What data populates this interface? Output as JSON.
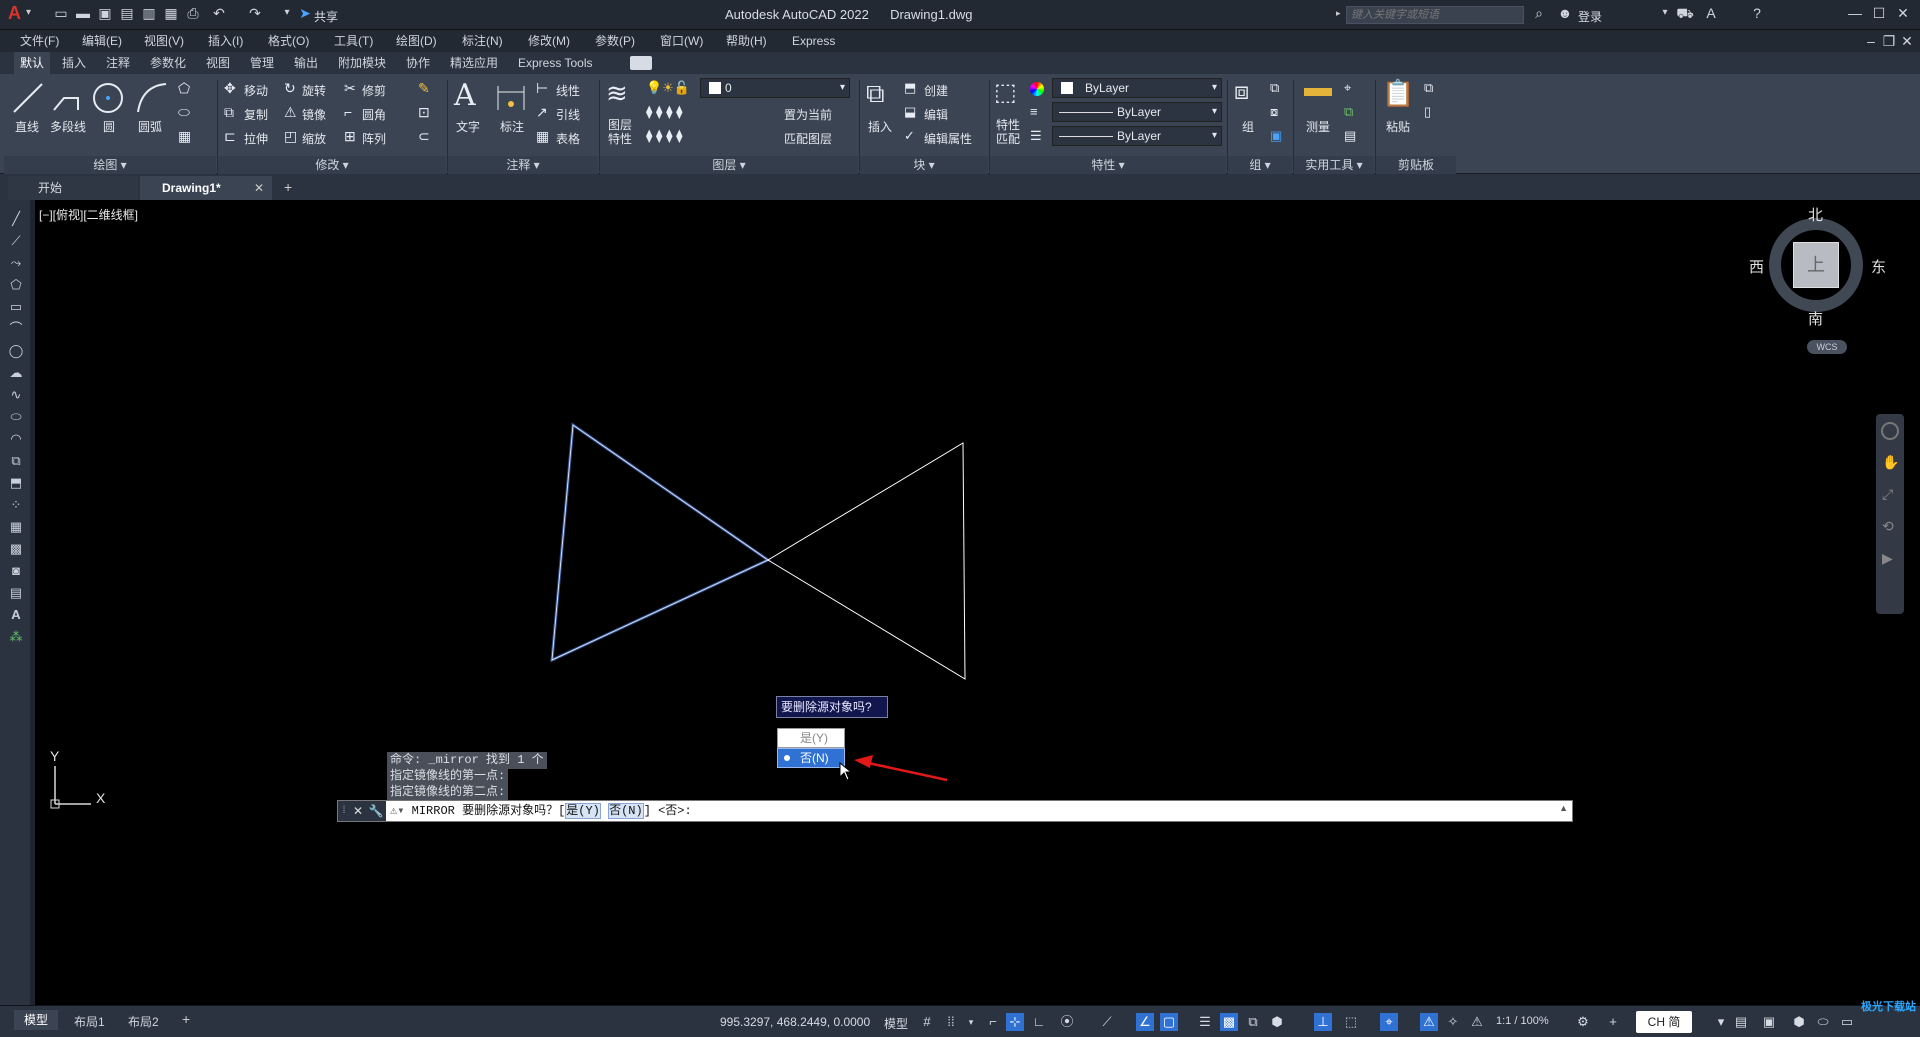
{
  "app": {
    "title": "Autodesk AutoCAD 2022",
    "file": "Drawing1.dwg",
    "logo": "A"
  },
  "titlebar": {
    "share_label": "共享",
    "search_placeholder": "键入关键字或短语",
    "login_label": "登录"
  },
  "menu": [
    "文件(F)",
    "编辑(E)",
    "视图(V)",
    "插入(I)",
    "格式(O)",
    "工具(T)",
    "绘图(D)",
    "标注(N)",
    "修改(M)",
    "参数(P)",
    "窗口(W)",
    "帮助(H)",
    "Express"
  ],
  "ribbon_tabs": [
    "默认",
    "插入",
    "注释",
    "参数化",
    "视图",
    "管理",
    "输出",
    "附加模块",
    "协作",
    "精选应用",
    "Express Tools"
  ],
  "ribbon": {
    "draw": {
      "title": "绘图",
      "line": "直线",
      "polyline": "多段线",
      "circle": "圆",
      "arc": "圆弧"
    },
    "modify": {
      "title": "修改",
      "move": "移动",
      "rotate": "旋转",
      "trim": "修剪",
      "copy": "复制",
      "mirror": "镜像",
      "fillet": "圆角",
      "stretch": "拉伸",
      "scale": "缩放",
      "array": "阵列"
    },
    "annotation": {
      "title": "注释",
      "text": "文字",
      "dimension": "标注",
      "linear": "线性",
      "leader": "引线",
      "table": "表格"
    },
    "layers": {
      "title": "图层",
      "layer_props": "图层特性",
      "layer_name": "0",
      "set_current": "置为当前",
      "match_layer": "匹配图层"
    },
    "block": {
      "title": "块",
      "insert": "插入",
      "create": "创建",
      "edit": "编辑",
      "edit_attr": "编辑属性"
    },
    "properties": {
      "title": "特性",
      "match": "特性匹配",
      "color": "ByLayer",
      "linetype": "ByLayer",
      "lineweight": "ByLayer"
    },
    "groups": {
      "title": "组",
      "group": "组"
    },
    "utilities": {
      "title": "实用工具",
      "measure": "测量"
    },
    "clipboard": {
      "title": "剪贴板",
      "paste": "粘贴"
    }
  },
  "doc_tabs": {
    "start": "开始",
    "drawing": "Drawing1*"
  },
  "viewport": {
    "label": "[−][俯视][二维线框]"
  },
  "viewcube": {
    "north": "北",
    "south": "南",
    "east": "东",
    "west": "西",
    "top": "上",
    "wcs": "WCS"
  },
  "ucs": {
    "x": "X",
    "y": "Y"
  },
  "prompt": {
    "question": "要删除源对象吗?",
    "options": [
      "是(Y)",
      "否(N)"
    ],
    "selected": "否(N)"
  },
  "command_history": [
    "命令: _mirror 找到 1 个",
    "指定镜像线的第一点:",
    "指定镜像线的第二点:"
  ],
  "command_line": {
    "text": "MIRROR 要删除源对象吗？[",
    "opt_yes": "是(Y)",
    "opt_no": "否(N)",
    "suffix": "] <否>:"
  },
  "layout_tabs": [
    "模型",
    "布局1",
    "布局2"
  ],
  "status": {
    "coords": "995.3297, 468.2449, 0.0000",
    "model": "模型",
    "scale": "1:1 / 100%",
    "ime": "CH 简"
  },
  "watermark": "极光下载站",
  "colors": {
    "accent": "#1f6fd6",
    "selected_line": "#5b8cf0",
    "canvas": "#000000"
  }
}
